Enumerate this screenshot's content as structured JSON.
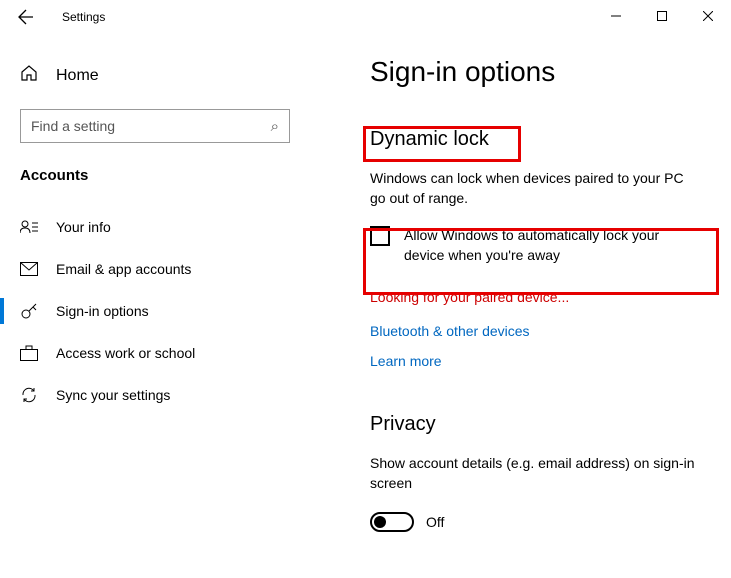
{
  "titlebar": {
    "title": "Settings"
  },
  "sidebar": {
    "home": "Home",
    "search_placeholder": "Find a setting",
    "group": "Accounts",
    "items": [
      {
        "label": "Your info"
      },
      {
        "label": "Email & app accounts"
      },
      {
        "label": "Sign-in options"
      },
      {
        "label": "Access work or school"
      },
      {
        "label": "Sync your settings"
      }
    ]
  },
  "main": {
    "page_title": "Sign-in options",
    "dynamic_lock": {
      "heading": "Dynamic lock",
      "desc": "Windows can lock when devices paired to your PC go out of range.",
      "checkbox_label": "Allow Windows to automatically lock your device when you're away",
      "status": "Looking for your paired device...",
      "link_bt": "Bluetooth & other devices",
      "link_learn": "Learn more"
    },
    "privacy": {
      "heading": "Privacy",
      "desc": "Show account details (e.g. email address) on sign-in screen",
      "toggle_state": "Off"
    }
  }
}
